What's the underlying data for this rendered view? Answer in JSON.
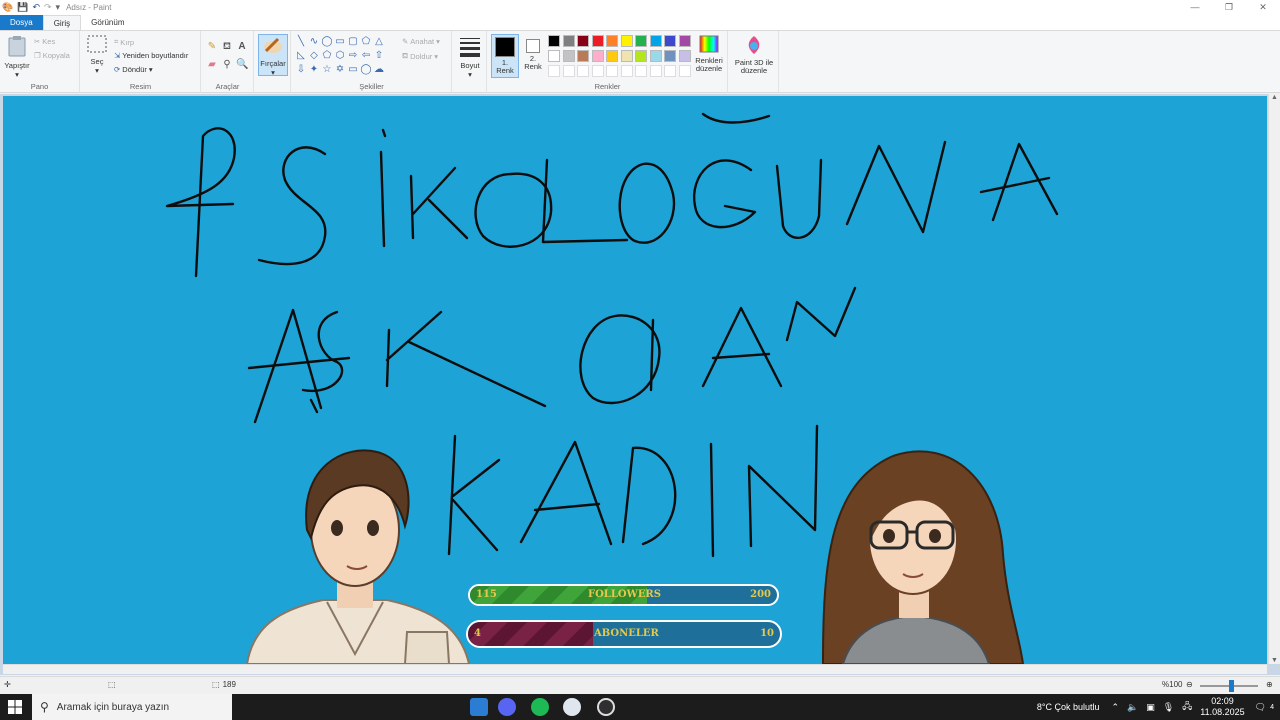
{
  "window": {
    "title": "Adsız - Paint",
    "min_glyph": "—",
    "max_glyph": "❐",
    "close_glyph": "✕"
  },
  "tabs": [
    "Dosya",
    "Giriş",
    "Görünüm"
  ],
  "ribbon": {
    "pano": {
      "label": "Pano",
      "paste": "Yapıştır",
      "cut": "Kes",
      "copy": "Kopyala"
    },
    "resim": {
      "label": "Resim",
      "select": "Seç",
      "crop": "Kırp",
      "resize": "Yeniden boyutlandır",
      "rotate": "Döndür"
    },
    "araclar": {
      "label": "Araçlar"
    },
    "brushes": {
      "label": "Fırçalar"
    },
    "sekiller": {
      "label": "Şekiller",
      "outline": "Anahat",
      "fill": "Doldur"
    },
    "size": {
      "label": "Boyut"
    },
    "colors": {
      "label": "Renkler",
      "color1": "1. Renk",
      "color2": "2. Renk",
      "edit": "Renkleri düzenle",
      "paint3d": "Paint 3D ile düzenle",
      "palette_row1": [
        "#000000",
        "#7f7f7f",
        "#880015",
        "#ed1c24",
        "#ff7f27",
        "#fff200",
        "#22b14c",
        "#00a2e8",
        "#3f48cc",
        "#a349a4"
      ],
      "palette_row2": [
        "#ffffff",
        "#c3c3c3",
        "#b97a57",
        "#ffaec9",
        "#ffc90e",
        "#efe4b0",
        "#b5e61d",
        "#99d9ea",
        "#7092be",
        "#c8bfe7"
      ]
    }
  },
  "canvas": {
    "background": "#1da3d6",
    "handwriting_lines": [
      "PSİKOLOĞUNA",
      "AŞK OLAN",
      "KADIN"
    ]
  },
  "overlay": {
    "followers": {
      "label": "FOLLOWERS",
      "current": "115",
      "goal": "200",
      "fill_fraction": 0.575
    },
    "subscribers": {
      "label": "ABONELER",
      "current": "4",
      "goal": "10",
      "fill_fraction": 0.4
    }
  },
  "statusbar": {
    "canvas_size_partial": "189",
    "zoom": "%100"
  },
  "taskbar": {
    "search_placeholder": "Aramak için buraya yazın",
    "weather": "8°C  Çok bulutlu",
    "time": "02:09",
    "date": "11.08.2025",
    "notification_count": "4"
  }
}
